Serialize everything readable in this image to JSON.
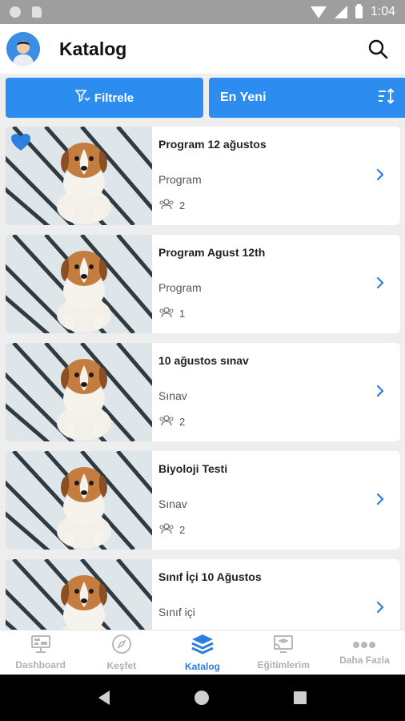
{
  "status_bar": {
    "time": "1:04"
  },
  "app_bar": {
    "title": "Katalog",
    "avatar_icon": "user-avatar-icon",
    "search_icon": "search-icon"
  },
  "filters": {
    "filter_label": "Filtrele",
    "sort_label": "En Yeni",
    "accent": "#2d8cf0"
  },
  "catalog": {
    "items": [
      {
        "title": "Program 12 ağustos",
        "type": "Program",
        "count": "2",
        "favorite": true
      },
      {
        "title": "Program Agust 12th",
        "type": "Program",
        "count": "1",
        "favorite": false
      },
      {
        "title": "10 ağustos sınav",
        "type": "Sınav",
        "count": "2",
        "favorite": false
      },
      {
        "title": "Biyoloji Testi",
        "type": "Sınav",
        "count": "2",
        "favorite": false
      },
      {
        "title": "Sınıf İçi 10 Ağustos",
        "type": "Sınıf içi",
        "count": "",
        "favorite": false
      }
    ]
  },
  "bottom_nav": {
    "items": [
      {
        "label": "Dashboard",
        "icon": "monitor-icon"
      },
      {
        "label": "Keşfet",
        "icon": "compass-icon"
      },
      {
        "label": "Katalog",
        "icon": "layers-icon",
        "active": true
      },
      {
        "label": "Eğitimlerim",
        "icon": "cast-icon"
      },
      {
        "label": "Daha Fazla",
        "icon": "more-icon"
      }
    ]
  }
}
